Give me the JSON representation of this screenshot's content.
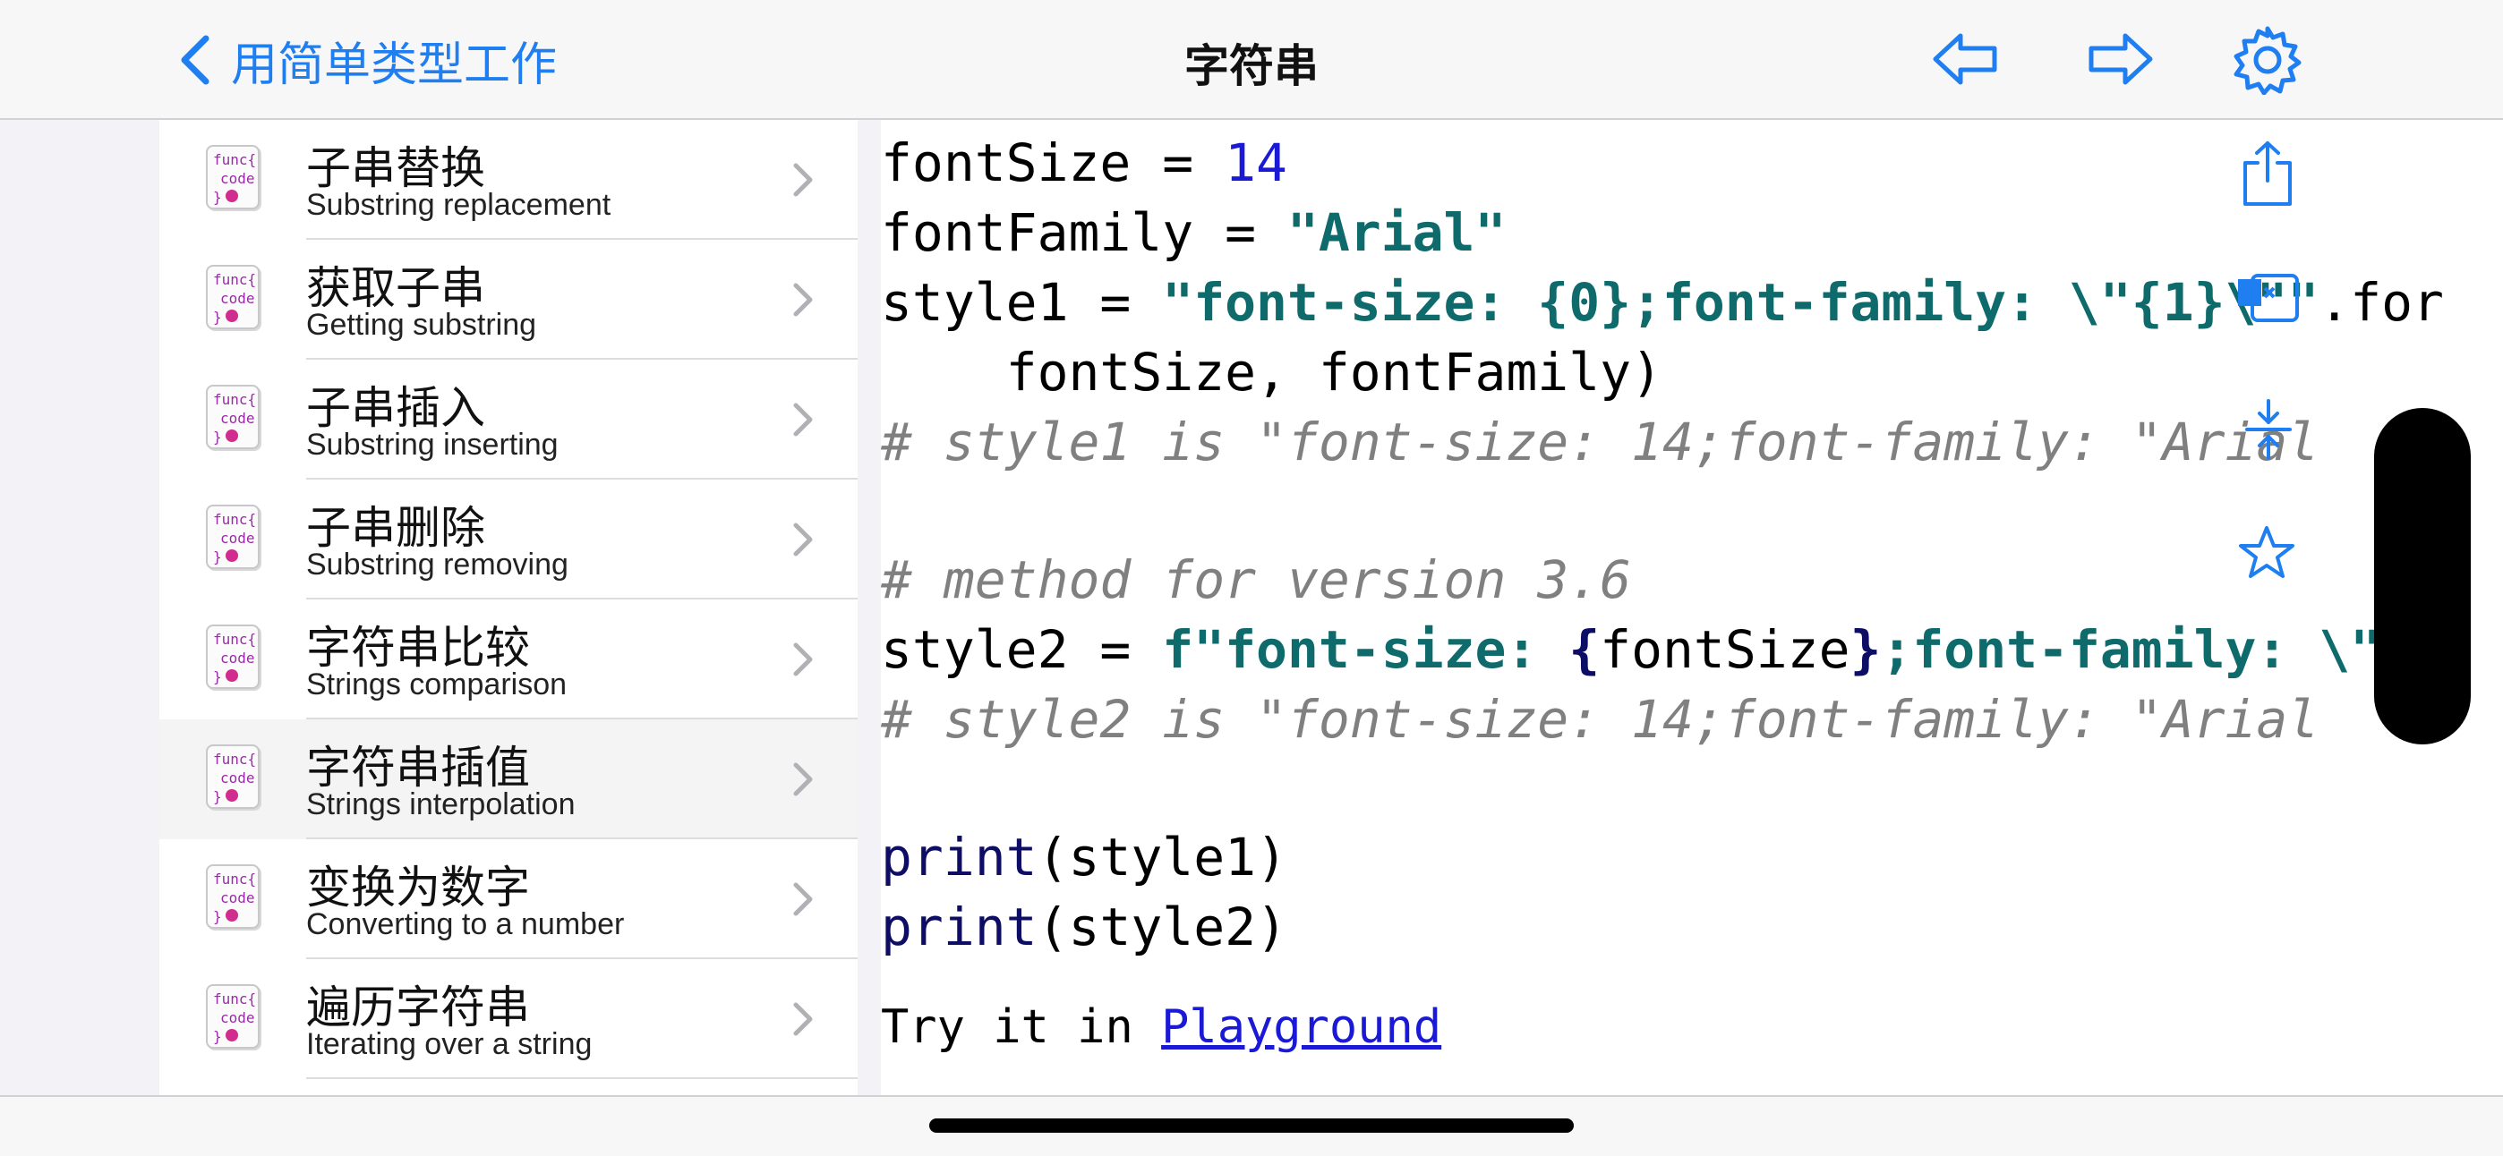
{
  "nav": {
    "back_label": "用简单类型工作",
    "title": "字符串"
  },
  "colors": {
    "accent": "#1f7ef0",
    "string": "#0f6b6b",
    "number": "#1a1ad6",
    "comment": "#808080"
  },
  "list": {
    "items": [
      {
        "title": "子串替换",
        "subtitle": "Substring replacement",
        "icon": "func-code-icon"
      },
      {
        "title": "获取子串",
        "subtitle": "Getting substring",
        "icon": "func-code-icon"
      },
      {
        "title": "子串插入",
        "subtitle": "Substring inserting",
        "icon": "func-code-icon"
      },
      {
        "title": "子串删除",
        "subtitle": "Substring removing",
        "icon": "func-code-icon"
      },
      {
        "title": "字符串比较",
        "subtitle": "Strings comparison",
        "icon": "func-code-icon"
      },
      {
        "title": "字符串插值",
        "subtitle": "Strings interpolation",
        "icon": "func-code-icon",
        "selected": true
      },
      {
        "title": "变换为数字",
        "subtitle": "Converting to a number",
        "icon": "func-code-icon"
      },
      {
        "title": "遍历字符串",
        "subtitle": "Iterating over a string",
        "icon": "func-code-icon"
      }
    ],
    "icon_text": {
      "line1": "func{",
      "line2": "code",
      "line3": "}"
    }
  },
  "code": {
    "l1_var": "fontSize = ",
    "l1_val": "14",
    "l2_var": "fontFamily = ",
    "l2_val": "\"Arial\"",
    "l3_var": "style1 = ",
    "l3_val": "\"font-size: {0};font-family: \\\"{1}\\\"\"",
    "l3_tail": ".for",
    "l4": "    fontSize, fontFamily)",
    "l5_comment": "# style1 is \"font-size: 14;font-family: \"Arial",
    "l7_comment": "# method for version 3.6",
    "l8_var": "style2 = ",
    "l8_prefix": "f\"font-size: ",
    "l8_brace_open": "{",
    "l8_name": "fontSize",
    "l8_brace_close": "}",
    "l8_rest": ";font-family: ",
    "l8_tail": "\\\"{f",
    "l9_comment": "# style2 is \"font-size: 14;font-family: \"Arial",
    "print1_fn": "print",
    "print1_args": "(style1)",
    "print2_fn": "print",
    "print2_args": "(style2)",
    "try_text": "Try it in ",
    "try_link": "Playground"
  }
}
